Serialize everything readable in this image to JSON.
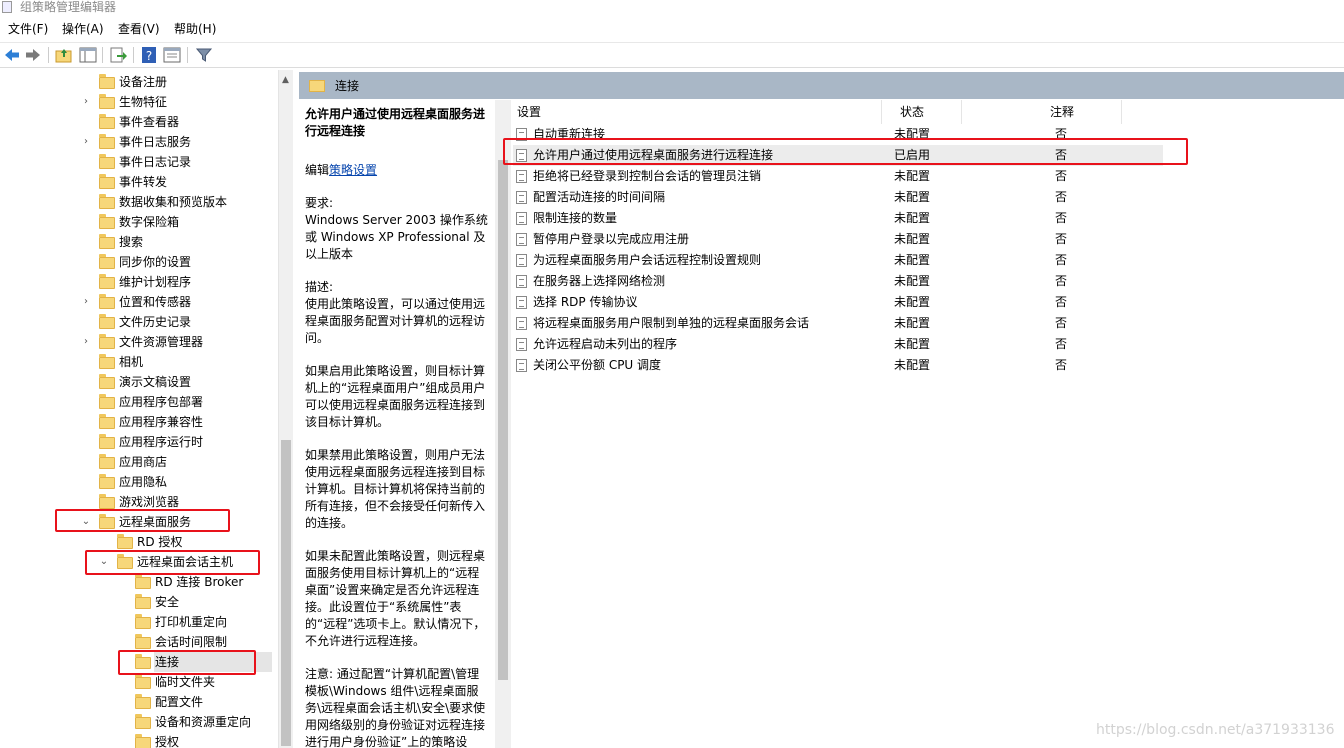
{
  "window": {
    "title": "组策略管理编辑器"
  },
  "menu": [
    {
      "label": "文件(F)"
    },
    {
      "label": "操作(A)"
    },
    {
      "label": "查看(V)"
    },
    {
      "label": "帮助(H)"
    }
  ],
  "toolbar": [
    "back-arrow-icon",
    "forward-arrow-icon",
    "up-folder-icon",
    "show-tree-icon",
    "export-list-icon",
    "help-icon",
    "properties-icon",
    "filter-icon"
  ],
  "tree": [
    {
      "label": "设备注册",
      "level": 0,
      "arrow": ""
    },
    {
      "label": "生物特征",
      "level": 0,
      "arrow": "›"
    },
    {
      "label": "事件查看器",
      "level": 0,
      "arrow": ""
    },
    {
      "label": "事件日志服务",
      "level": 0,
      "arrow": "›"
    },
    {
      "label": "事件日志记录",
      "level": 0,
      "arrow": ""
    },
    {
      "label": "事件转发",
      "level": 0,
      "arrow": ""
    },
    {
      "label": "数据收集和预览版本",
      "level": 0,
      "arrow": ""
    },
    {
      "label": "数字保险箱",
      "level": 0,
      "arrow": ""
    },
    {
      "label": "搜索",
      "level": 0,
      "arrow": ""
    },
    {
      "label": "同步你的设置",
      "level": 0,
      "arrow": ""
    },
    {
      "label": "维护计划程序",
      "level": 0,
      "arrow": ""
    },
    {
      "label": "位置和传感器",
      "level": 0,
      "arrow": "›"
    },
    {
      "label": "文件历史记录",
      "level": 0,
      "arrow": ""
    },
    {
      "label": "文件资源管理器",
      "level": 0,
      "arrow": "›"
    },
    {
      "label": "相机",
      "level": 0,
      "arrow": ""
    },
    {
      "label": "演示文稿设置",
      "level": 0,
      "arrow": ""
    },
    {
      "label": "应用程序包部署",
      "level": 0,
      "arrow": ""
    },
    {
      "label": "应用程序兼容性",
      "level": 0,
      "arrow": ""
    },
    {
      "label": "应用程序运行时",
      "level": 0,
      "arrow": ""
    },
    {
      "label": "应用商店",
      "level": 0,
      "arrow": ""
    },
    {
      "label": "应用隐私",
      "level": 0,
      "arrow": ""
    },
    {
      "label": "游戏浏览器",
      "level": 0,
      "arrow": ""
    },
    {
      "label": "远程桌面服务",
      "level": 0,
      "arrow": "⌄"
    },
    {
      "label": "RD 授权",
      "level": 1,
      "arrow": ""
    },
    {
      "label": "远程桌面会话主机",
      "level": 1,
      "arrow": "⌄"
    },
    {
      "label": "RD 连接 Broker",
      "level": 2,
      "arrow": ""
    },
    {
      "label": "安全",
      "level": 2,
      "arrow": ""
    },
    {
      "label": "打印机重定向",
      "level": 2,
      "arrow": ""
    },
    {
      "label": "会话时间限制",
      "level": 2,
      "arrow": ""
    },
    {
      "label": "连接",
      "level": 2,
      "arrow": "",
      "selected": true
    },
    {
      "label": "临时文件夹",
      "level": 2,
      "arrow": ""
    },
    {
      "label": "配置文件",
      "level": 2,
      "arrow": ""
    },
    {
      "label": "设备和资源重定向",
      "level": 2,
      "arrow": ""
    },
    {
      "label": "授权",
      "level": 2,
      "arrow": ""
    }
  ],
  "right": {
    "header": "连接",
    "desc": {
      "title": "允许用户通过使用远程桌面服务进行远程连接",
      "edit_prefix": "编辑",
      "edit_link": "策略设置",
      "req_label": "要求:",
      "req_text": "Windows Server 2003 操作系统或 Windows XP Professional 及以上版本",
      "desc_label": "描述:",
      "p1": "使用此策略设置，可以通过使用远程桌面服务配置对计算机的远程访问。",
      "p2": "如果启用此策略设置，则目标计算机上的“远程桌面用户”组成员用户可以使用远程桌面服务远程连接到该目标计算机。",
      "p3": "如果禁用此策略设置，则用户无法使用远程桌面服务远程连接到目标计算机。目标计算机将保持当前的所有连接，但不会接受任何新传入的连接。",
      "p4": "如果未配置此策略设置，则远程桌面服务使用目标计算机上的“远程桌面”设置来确定是否允许远程连接。此设置位于“系统属性”表的“远程”选项卡上。默认情况下，不允许进行远程连接。",
      "p5": "注意: 通过配置“计算机配置\\管理模板\\Windows 组件\\远程桌面服务\\远程桌面会话主机\\安全\\要求使用网络级别的身份验证对远程连接进行用户身份验证”上的策略设置，可"
    },
    "columns": {
      "setting": "设置",
      "state": "状态",
      "comment": "注释"
    },
    "rows": [
      {
        "name": "自动重新连接",
        "state": "未配置",
        "comment": "否"
      },
      {
        "name": "允许用户通过使用远程桌面服务进行远程连接",
        "state": "已启用",
        "comment": "否",
        "highlight": true
      },
      {
        "name": "拒绝将已经登录到控制台会话的管理员注销",
        "state": "未配置",
        "comment": "否"
      },
      {
        "name": "配置活动连接的时间间隔",
        "state": "未配置",
        "comment": "否"
      },
      {
        "name": "限制连接的数量",
        "state": "未配置",
        "comment": "否"
      },
      {
        "name": "暂停用户登录以完成应用注册",
        "state": "未配置",
        "comment": "否"
      },
      {
        "name": "为远程桌面服务用户会话远程控制设置规则",
        "state": "未配置",
        "comment": "否"
      },
      {
        "name": "在服务器上选择网络检测",
        "state": "未配置",
        "comment": "否"
      },
      {
        "name": "选择 RDP 传输协议",
        "state": "未配置",
        "comment": "否"
      },
      {
        "name": "将远程桌面服务用户限制到单独的远程桌面服务会话",
        "state": "未配置",
        "comment": "否"
      },
      {
        "name": "允许远程启动未列出的程序",
        "state": "未配置",
        "comment": "否"
      },
      {
        "name": "关闭公平份额 CPU 调度",
        "state": "未配置",
        "comment": "否"
      }
    ]
  },
  "watermark": "https://blog.csdn.net/a371933136",
  "colors": {
    "annotation_red": "#e8121b",
    "header_bar": "#a9b7c6",
    "link": "#0645ad"
  }
}
